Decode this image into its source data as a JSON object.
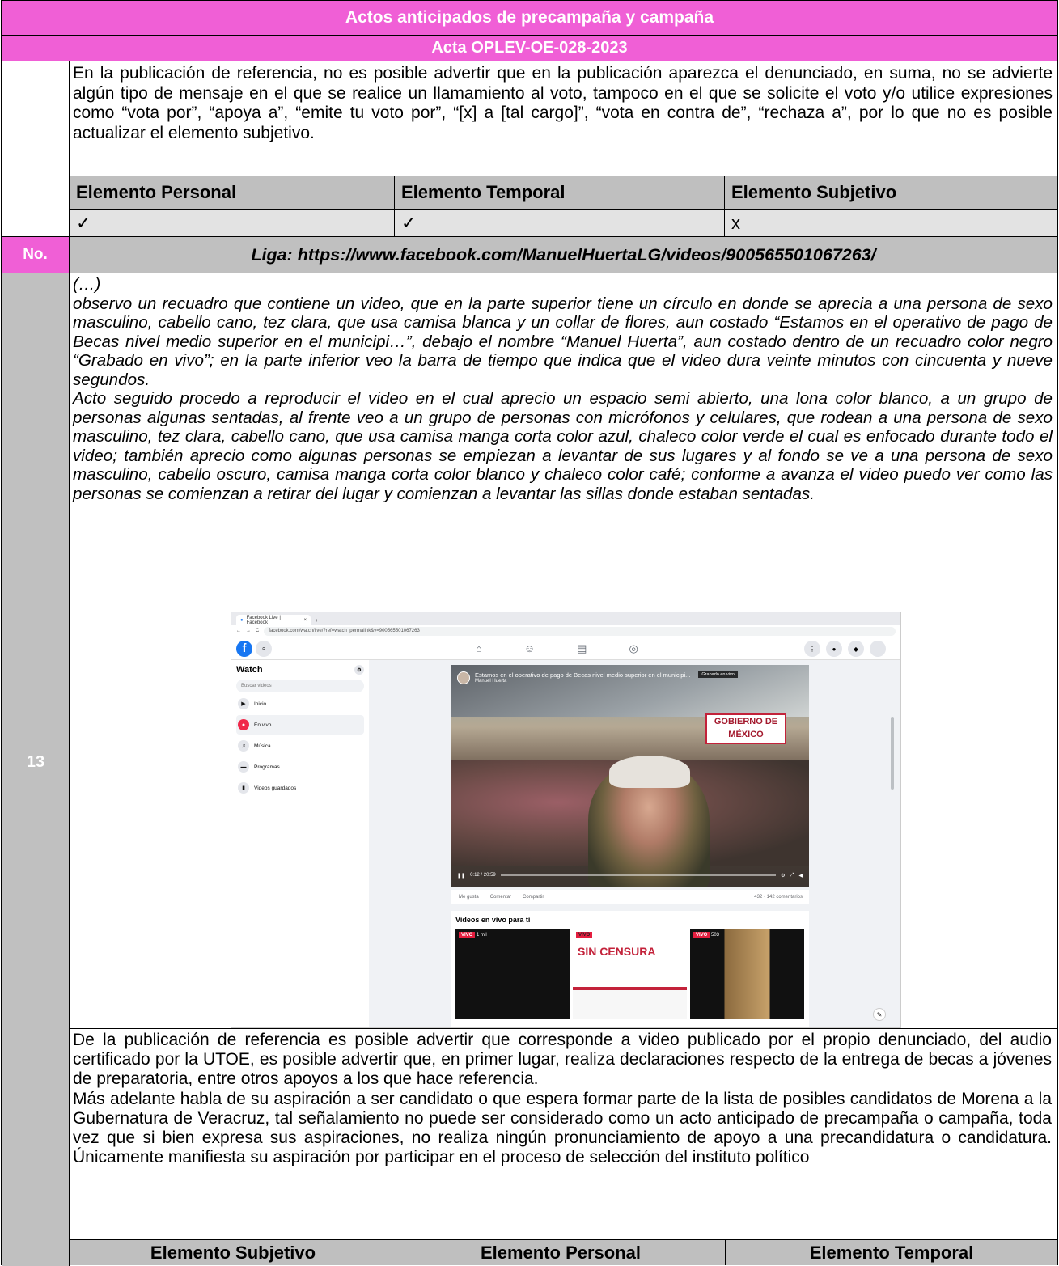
{
  "header": {
    "title": "Actos anticipados de precampaña y campaña",
    "acta": "Acta OPLEV-OE-028-2023"
  },
  "first_block": {
    "analysis": "En la publicación de referencia, no es posible advertir que en la publicación aparezca el denunciado, en suma, no se advierte algún tipo de mensaje en el que se realice un llamamiento al voto, tampoco en el que se solicite el voto y/o utilice expresiones como “vota por”, “apoya a”, “emite tu voto por”, “[x] a [tal cargo]”, “vota en contra de”, “rechaza a”, por lo que no es posible actualizar el elemento subjetivo.",
    "elements_header": [
      "Elemento Personal",
      "Elemento Temporal",
      "Elemento Subjetivo"
    ],
    "elements_values": [
      "✓",
      "✓",
      "x"
    ]
  },
  "link_row": {
    "no_label": "No.",
    "link": "Liga: https://www.facebook.com/ManuelHuertaLG/videos/900565501067263/"
  },
  "entry": {
    "number": "13",
    "ellipsis": "(…)",
    "description_1": "observo un recuadro que contiene un video, que en la parte superior tiene un círculo en donde se aprecia a una persona de sexo masculino, cabello cano, tez clara, que usa camisa blanca y un collar de flores, aun costado “Estamos en el operativo de pago de Becas nivel medio superior en el municipi…”, debajo el nombre “Manuel Huerta”, aun costado dentro de un recuadro color negro “Grabado en vivo”; en la parte inferior veo la barra de tiempo que indica que el video dura veinte minutos con cincuenta y nueve segundos.",
    "description_2": "Acto seguido procedo a reproducir el video en el cual aprecio un espacio semi abierto, una lona color blanco, a un grupo de personas algunas sentadas, al frente veo a un grupo de personas con micrófonos y celulares, que rodean a una persona de sexo masculino, tez clara, cabello cano, que usa camisa manga corta color azul, chaleco color verde el cual es enfocado durante todo el video; también aprecio como algunas personas se empiezan a levantar de sus lugares y al fondo se ve a una persona de sexo masculino, cabello oscuro, camisa manga corta color blanco y chaleco color café; conforme a avanza el video puedo ver como las personas se comienzan a retirar del lugar y comienzan a levantar las sillas donde estaban sentadas.",
    "analysis_1": "De la publicación de referencia es posible advertir que corresponde a video publicado por el propio denunciado, del audio certificado por la UTOE, es posible advertir que, en primer lugar, realiza declaraciones respecto de la entrega de becas a jóvenes de preparatoria, entre otros apoyos a los que hace referencia.",
    "analysis_2": "Más adelante habla de su aspiración a ser candidato o que espera formar parte de la lista de posibles candidatos de Morena a la Gubernatura de Veracruz, tal señalamiento no puede ser considerado como un acto anticipado de precampaña o campaña, toda vez que si bien expresa sus aspiraciones, no realiza ningún pronunciamiento de apoyo a una precandidatura o candidatura. Únicamente manifiesta su aspiración por participar en el proceso de selección del instituto político",
    "elements_header": [
      "Elemento Subjetivo",
      "Elemento Personal",
      "Elemento Temporal"
    ]
  },
  "screenshot": {
    "tab_title": "Facebook Live | Facebook",
    "url": "facebook.com/watch/live/?ref=watch_permalink&v=900565501067263",
    "sidebar_title": "Watch",
    "search_placeholder": "Buscar videos",
    "menu": [
      "Inicio",
      "En vivo",
      "Música",
      "Programas",
      "Videos guardados"
    ],
    "video_title": "Estamos en el operativo de pago de Becas nivel medio superior en el municipi...",
    "video_author": "Manuel Huerta",
    "video_badge": "Grabado en vivo",
    "video_time": "0:12 / 20:59",
    "banner_text": "GOBIERNO DE MÉXICO",
    "actions": [
      "Me gusta",
      "Comentar",
      "Compartir"
    ],
    "reactions_count": "432 · 142 comentarios",
    "recommend_title": "Videos en vivo para ti",
    "thumbs": [
      {
        "badge": "VIVO",
        "views": "1 mil"
      },
      {
        "badge": "VIVO",
        "views": "",
        "brand": "SIN CENSURA"
      },
      {
        "badge": "VIVO",
        "views": "503"
      }
    ]
  }
}
